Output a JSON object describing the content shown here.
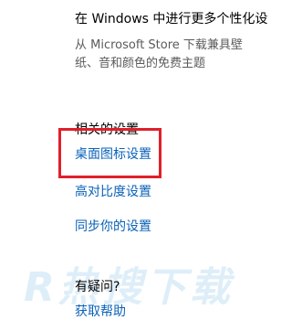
{
  "personalize": {
    "heading": "在 Windows 中进行更多个性化设",
    "description": "从 Microsoft Store 下载兼具壁纸、音和颜色的免费主题"
  },
  "related_settings": {
    "title": "相关的设置",
    "links": [
      "桌面图标设置",
      "高对比度设置",
      "同步你的设置"
    ]
  },
  "help": {
    "title": "有疑问?",
    "link": "获取帮助"
  },
  "watermark": {
    "text": "R热搜下载"
  },
  "colors": {
    "link": "#0a62b8",
    "highlight": "#e0202a"
  }
}
